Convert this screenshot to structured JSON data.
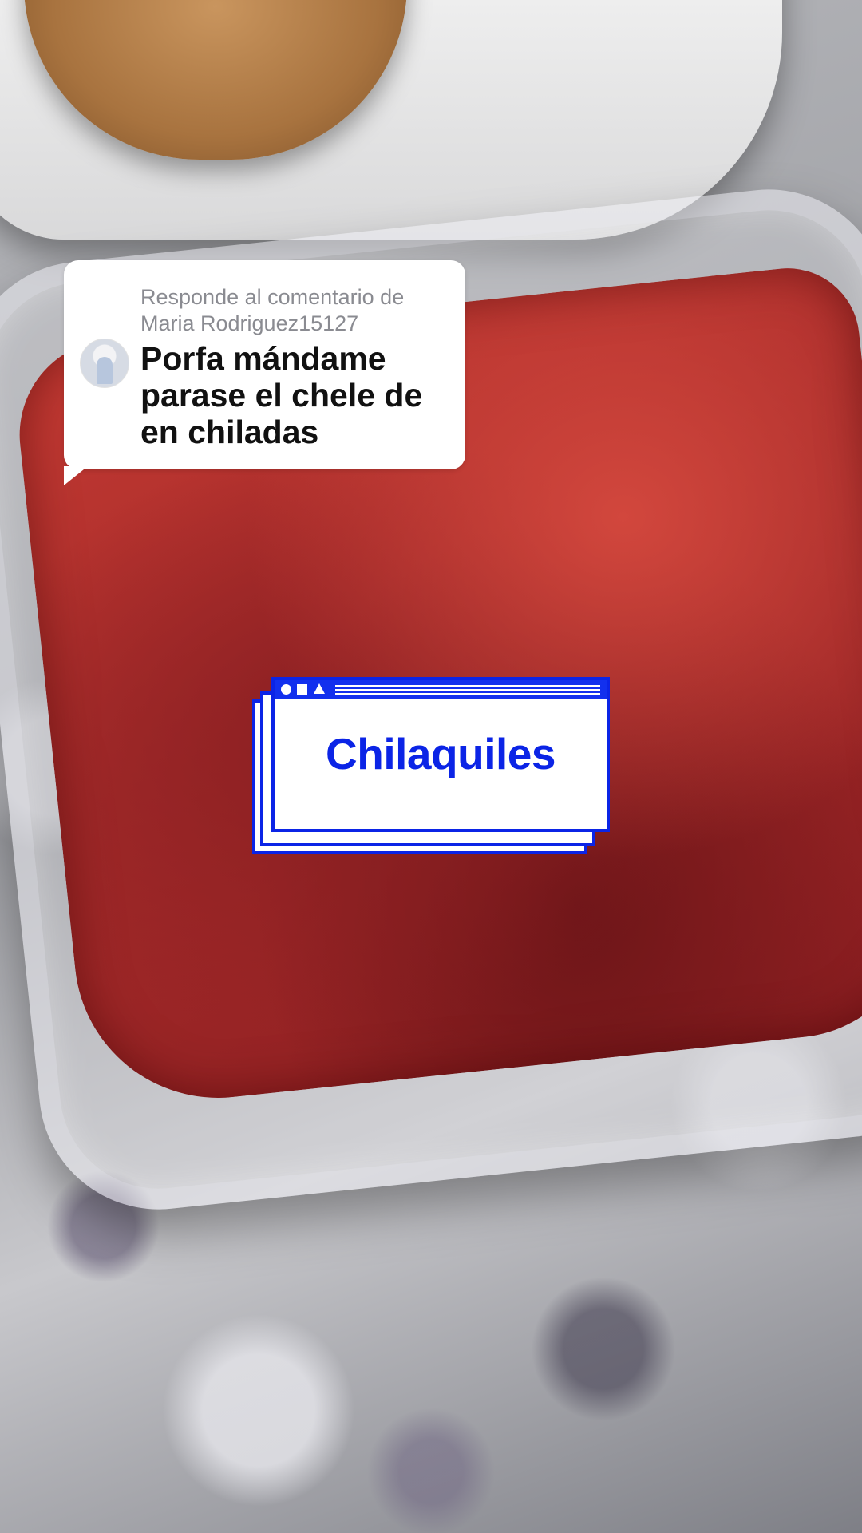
{
  "reply": {
    "label": "Responde al comentario de Maria Rodriguez15127",
    "comment": "Porfa mándame parase el chele de en chiladas"
  },
  "sticker": {
    "title": "Chilaquiles",
    "accent_color": "#0b24e6"
  },
  "icons": [
    "window-circle-icon",
    "window-square-icon",
    "window-triangle-icon"
  ]
}
